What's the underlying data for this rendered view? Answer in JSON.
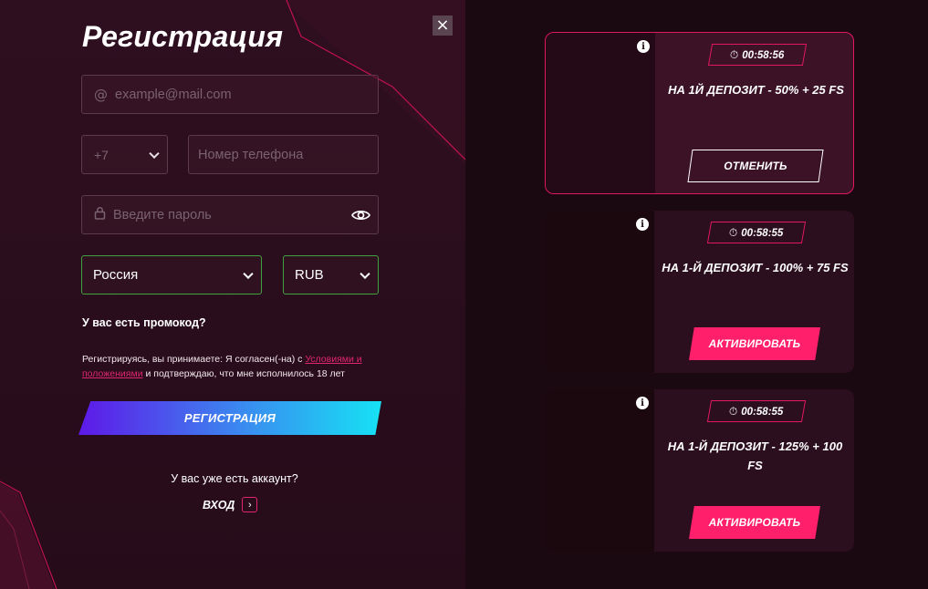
{
  "registration": {
    "title": "Регистрация",
    "email_placeholder": "example@mail.com",
    "phone_code": "+7",
    "phone_placeholder": "Номер телефона",
    "password_placeholder": "Введите пароль",
    "country": "Россия",
    "currency": "RUB",
    "promo_label": "У вас есть промокод?",
    "terms_prefix": "Регистрируясь, вы принимаете: Я согласен(-на) с ",
    "terms_link": "Условиями и положениями",
    "terms_suffix": " и подтверждаю, что мне исполнилось 18 лет",
    "register_button": "РЕГИСТРАЦИЯ",
    "have_account": "У вас уже есть аккаунт?",
    "login_label": "ВХОД"
  },
  "bonuses": [
    {
      "timer": "00:58:56",
      "title": "НА 1Й ДЕПОЗИТ - 50% + 25 FS",
      "button": "ОТМЕНИТЬ",
      "state": "active"
    },
    {
      "timer": "00:58:55",
      "title": "НА 1-Й ДЕПОЗИТ - 100% + 75 FS",
      "button": "АКТИВИРОВАТЬ",
      "state": "available"
    },
    {
      "timer": "00:58:55",
      "title": "НА 1-Й ДЕПОЗИТ - 125% + 100 FS",
      "button": "АКТИВИРОВАТЬ",
      "state": "available"
    }
  ],
  "icons": {
    "close": "close-icon",
    "email": "at-icon",
    "lock": "lock-icon",
    "eye": "eye-icon",
    "info": "info-icon",
    "stopwatch": "stopwatch-icon",
    "arrow": "chevron-right-icon"
  },
  "colors": {
    "accent": "#e2185f",
    "activate": "#ff1f6a",
    "valid_border": "#3fa342",
    "gradient_start": "#5e18e8",
    "gradient_end": "#16e2f4"
  }
}
